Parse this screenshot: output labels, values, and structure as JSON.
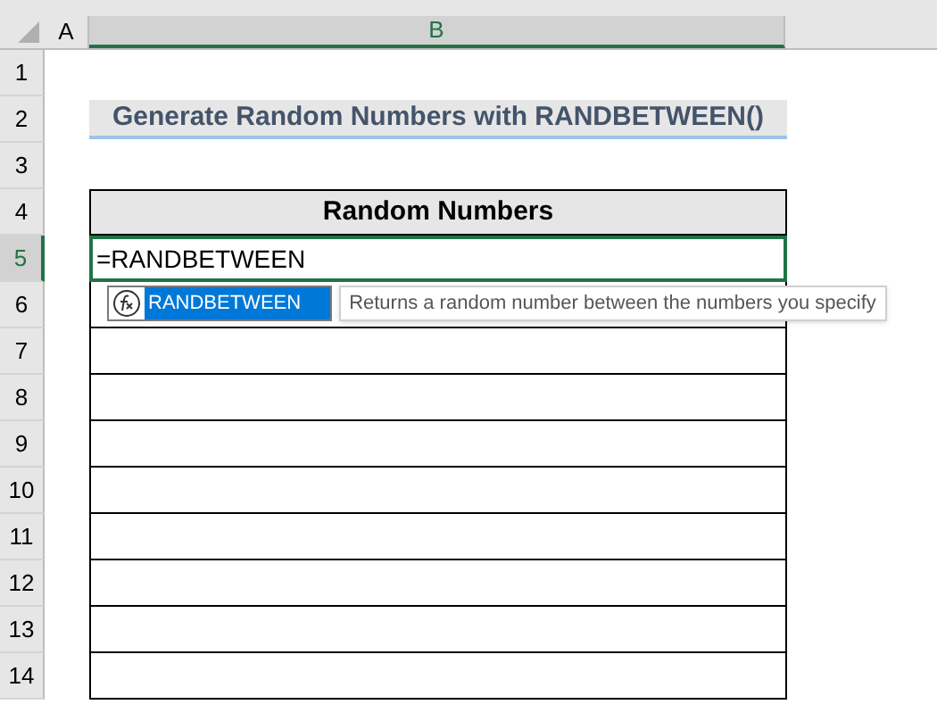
{
  "columns": [
    {
      "label": "A",
      "selected": false
    },
    {
      "label": "B",
      "selected": true
    }
  ],
  "rows": [
    {
      "label": "1",
      "selected": false,
      "kind": "blank"
    },
    {
      "label": "2",
      "selected": false,
      "kind": "title",
      "text": "Generate Random Numbers with RANDBETWEEN()"
    },
    {
      "label": "3",
      "selected": false,
      "kind": "blank"
    },
    {
      "label": "4",
      "selected": false,
      "kind": "header",
      "text": "Random Numbers"
    },
    {
      "label": "5",
      "selected": true,
      "kind": "editing",
      "text": "=RANDBETWEEN"
    },
    {
      "label": "6",
      "selected": false,
      "kind": "cell"
    },
    {
      "label": "7",
      "selected": false,
      "kind": "cell"
    },
    {
      "label": "8",
      "selected": false,
      "kind": "cell"
    },
    {
      "label": "9",
      "selected": false,
      "kind": "cell"
    },
    {
      "label": "10",
      "selected": false,
      "kind": "cell"
    },
    {
      "label": "11",
      "selected": false,
      "kind": "cell"
    },
    {
      "label": "12",
      "selected": false,
      "kind": "cell"
    },
    {
      "label": "13",
      "selected": false,
      "kind": "cell"
    },
    {
      "label": "14",
      "selected": false,
      "kind": "cell"
    }
  ],
  "autocomplete": {
    "items": [
      {
        "label": "RANDBETWEEN",
        "selected": true
      }
    ],
    "tooltip": "Returns a random number between the numbers you specify"
  }
}
